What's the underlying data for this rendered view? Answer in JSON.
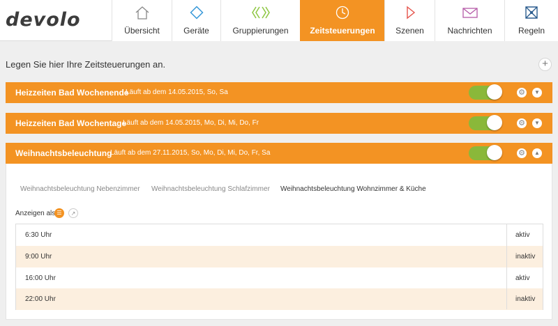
{
  "brand": {
    "logo_text": "devolo"
  },
  "nav": {
    "items": [
      {
        "label": "Übersicht",
        "icon": "home-icon"
      },
      {
        "label": "Geräte",
        "icon": "diamond-icon"
      },
      {
        "label": "Gruppierungen",
        "icon": "group-icon"
      },
      {
        "label": "Zeitsteuerungen",
        "icon": "clock-icon",
        "active": true
      },
      {
        "label": "Szenen",
        "icon": "play-icon"
      },
      {
        "label": "Nachrichten",
        "icon": "envelope-icon"
      },
      {
        "label": "Regeln",
        "icon": "rules-icon"
      }
    ]
  },
  "intro": {
    "text": "Legen Sie hier Ihre Zeitsteuerungen an.",
    "add_label": "+"
  },
  "schedules": [
    {
      "name": "Heizzeiten Bad Wochenende",
      "subtitle": "Läuft ab dem 14.05.2015, So, Sa",
      "enabled": true,
      "expanded": false
    },
    {
      "name": "Heizzeiten Bad Wochentage",
      "subtitle": "Läuft ab dem 14.05.2015, Mo, Di, Mi, Do, Fr",
      "enabled": true,
      "expanded": false
    },
    {
      "name": "Weihnachtsbeleuchtung",
      "subtitle": "Läuft ab dem 27.11.2015, So, Mo, Di, Mi, Do, Fr, Sa",
      "enabled": true,
      "expanded": true
    }
  ],
  "detail": {
    "tabs": [
      {
        "label": "Weihnachtsbeleuchtung Nebenzimmer"
      },
      {
        "label": "Weihnachtsbeleuchtung Schlafzimmer"
      },
      {
        "label": "Weihnachtsbeleuchtung Wohnzimmer & Küche",
        "active": true
      }
    ],
    "show_as_label": "Anzeigen als:",
    "rows": [
      {
        "time": "6:30 Uhr",
        "state": "aktiv"
      },
      {
        "time": "9:00 Uhr",
        "state": "inaktiv"
      },
      {
        "time": "16:00 Uhr",
        "state": "aktiv"
      },
      {
        "time": "22:00 Uhr",
        "state": "inaktiv"
      }
    ]
  },
  "colors": {
    "accent": "#f39323",
    "toggle_on": "#8ab83a",
    "row_alt": "#fcefdf"
  }
}
